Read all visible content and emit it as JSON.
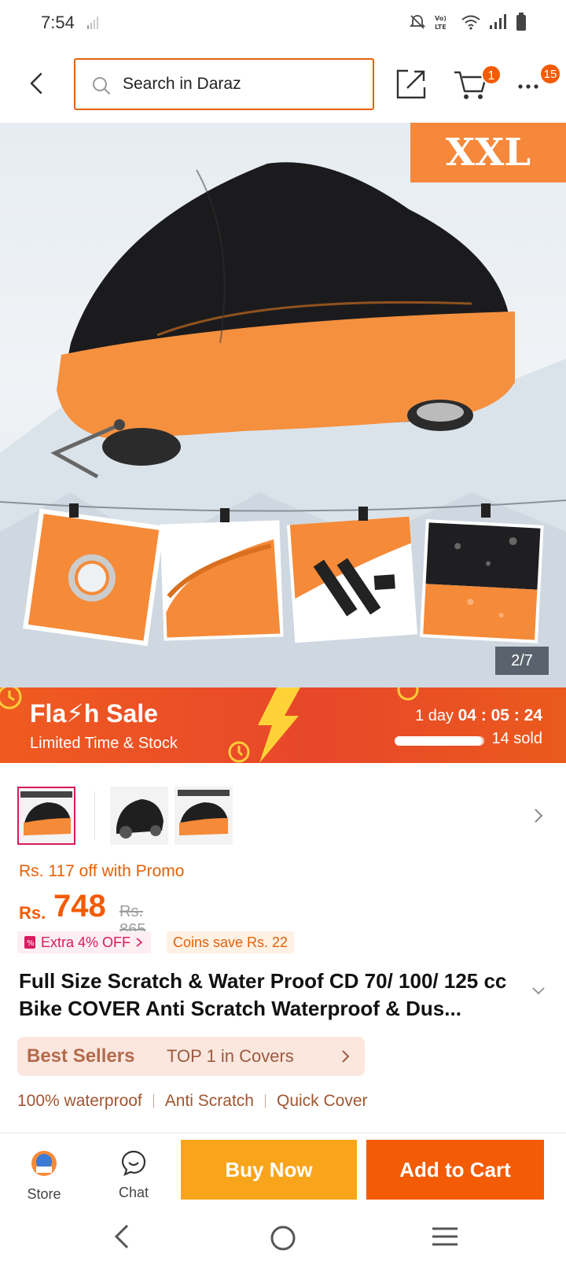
{
  "status_bar": {
    "time": "7:54",
    "icons": [
      "signal-weak-icon",
      "mute-icon",
      "volte-icon",
      "wifi-icon",
      "signal-icon",
      "battery-icon"
    ]
  },
  "header": {
    "search_placeholder": "Search in Daraz",
    "cart_count": "1",
    "more_count": "15",
    "accent": "#e1620a"
  },
  "gallery": {
    "size_tag": "XXL",
    "counter": "2/7"
  },
  "flash_sale": {
    "title": "Fla⚡h Sale",
    "subtitle": "Limited Time & Stock",
    "timer_prefix": "1 day",
    "timer": "04 : 05 : 24",
    "sold_fraction": 0.97,
    "sold_text": "14 sold"
  },
  "thumbnails": [
    "thumb-orange-black-cover",
    "thumb-black-cover",
    "thumb-orange-black-cover-2"
  ],
  "price": {
    "promo": "Rs. 117 off with Promo",
    "currency": "Rs.",
    "value": "748",
    "original": "Rs. 865",
    "extra_off": "Extra 4% OFF",
    "coins": "Coins save Rs. 22",
    "color": "#f35b04"
  },
  "product": {
    "title": "Full Size Scratch & Water Proof CD 70/ 100/ 125 cc Bike COVER Anti Scratch Waterproof & Dus..."
  },
  "best_sellers": {
    "label": "Best Sellers",
    "text": "TOP 1 in Covers"
  },
  "features": [
    "100% waterproof",
    "Anti Scratch",
    "Quick Cover"
  ],
  "bottom_bar": {
    "store_label": "Store",
    "chat_label": "Chat",
    "buy_now": "Buy Now",
    "add_to_cart": "Add to Cart"
  }
}
